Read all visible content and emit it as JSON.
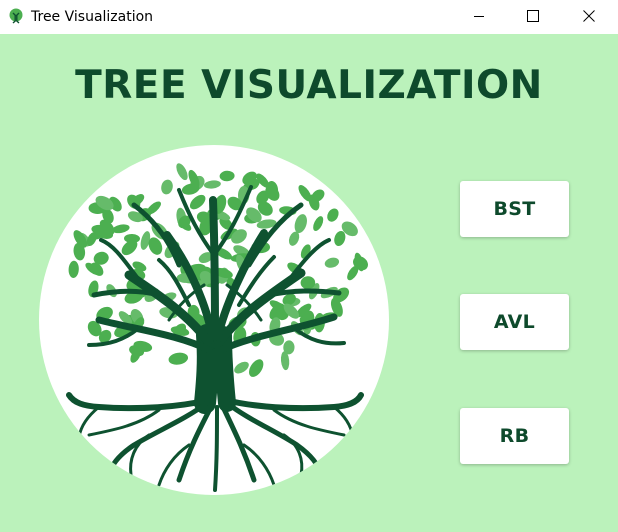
{
  "window": {
    "title": "Tree Visualization"
  },
  "main": {
    "heading": "TREE VISUALIZATION",
    "logo_icon": "tree-of-life-icon",
    "buttons": [
      {
        "label": "BST"
      },
      {
        "label": "AVL"
      },
      {
        "label": "RB"
      }
    ]
  },
  "colors": {
    "background": "#bbf2bb",
    "heading": "#0e4a2c",
    "trunk": "#0e5230",
    "leaf": "#4caf50",
    "button_bg": "#ffffff"
  }
}
